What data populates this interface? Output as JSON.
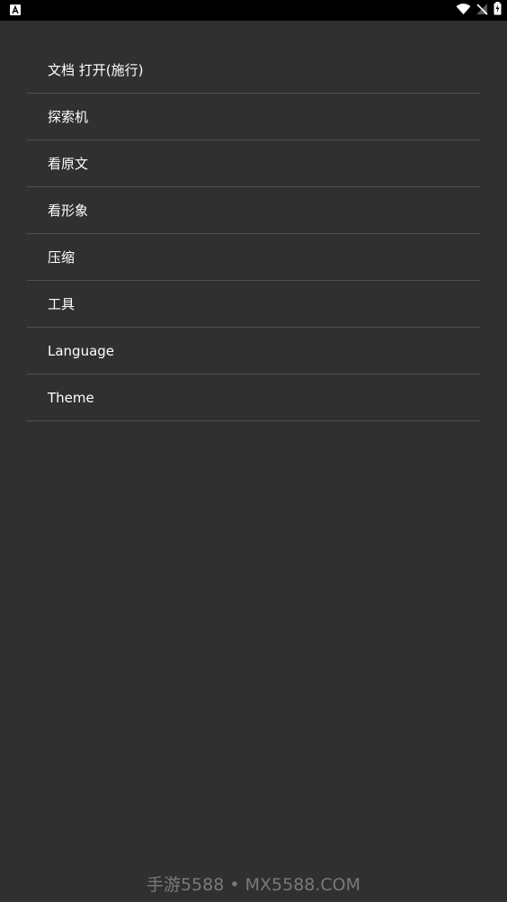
{
  "status_bar": {
    "left_icon": "a-letter-notification-icon",
    "right_icons": [
      "wifi-icon",
      "no-signal-icon",
      "battery-charging-icon"
    ]
  },
  "menu": {
    "items": [
      {
        "label": "文档 打开(施行)"
      },
      {
        "label": "探索机"
      },
      {
        "label": "看原文"
      },
      {
        "label": "看形象"
      },
      {
        "label": "压缩"
      },
      {
        "label": "工具"
      },
      {
        "label": "Language"
      },
      {
        "label": "Theme"
      }
    ]
  },
  "watermark": {
    "text": "手游5588 • MX5588.COM"
  },
  "colors": {
    "background": "#303030",
    "divider": "#505050",
    "text": "#ffffff",
    "status_bar": "#000000",
    "watermark": "#7a7a7a"
  }
}
